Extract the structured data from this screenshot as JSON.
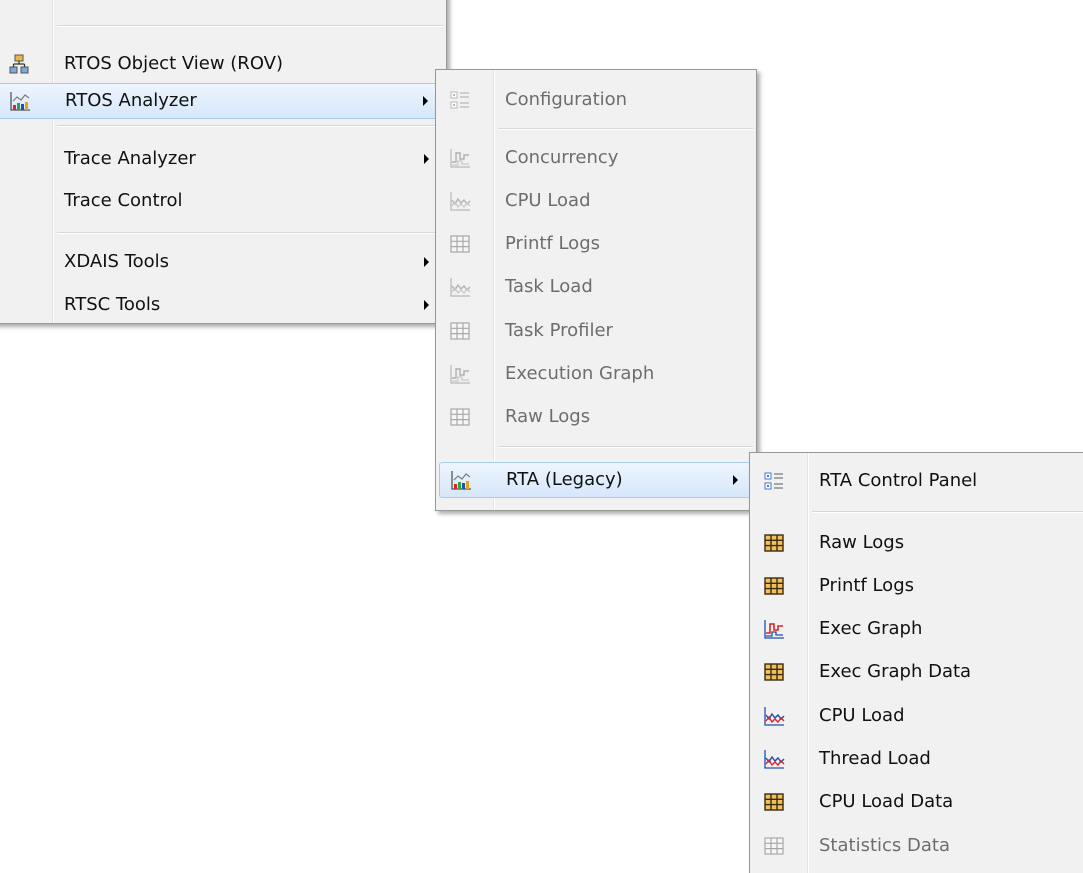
{
  "menu_main": {
    "items": [
      {
        "label": "RTOS Object View (ROV)",
        "icon": "rov-hierarchy-icon"
      },
      {
        "label": "RTOS Analyzer",
        "icon": "analyzer-chart-icon",
        "has_submenu": true,
        "active": true
      },
      {
        "label": "Trace Analyzer",
        "has_submenu": true
      },
      {
        "label": "Trace Control"
      },
      {
        "label": "XDAIS Tools",
        "has_submenu": true
      },
      {
        "label": "RTSC Tools",
        "has_submenu": true
      }
    ]
  },
  "menu_rtos_analyzer": {
    "items": [
      {
        "label": "Configuration",
        "icon": "configuration-icon",
        "disabled": true
      },
      {
        "label": "Concurrency",
        "icon": "step-graph-icon",
        "disabled": true
      },
      {
        "label": "CPU Load",
        "icon": "load-graph-icon",
        "disabled": true
      },
      {
        "label": "Printf Logs",
        "icon": "table-grid-icon",
        "disabled": true
      },
      {
        "label": "Task Load",
        "icon": "load-graph-icon",
        "disabled": true
      },
      {
        "label": "Task Profiler",
        "icon": "table-grid-icon",
        "disabled": true
      },
      {
        "label": "Execution Graph",
        "icon": "step-graph-icon",
        "disabled": true
      },
      {
        "label": "Raw Logs",
        "icon": "table-grid-icon",
        "disabled": true
      },
      {
        "label": "RTA (Legacy)",
        "icon": "analyzer-chart-icon",
        "has_submenu": true,
        "active": true
      }
    ]
  },
  "menu_rta_legacy": {
    "items": [
      {
        "label": "RTA Control Panel",
        "icon": "control-panel-icon"
      },
      {
        "label": "Raw Logs",
        "icon": "table-grid-icon"
      },
      {
        "label": "Printf Logs",
        "icon": "table-grid-icon"
      },
      {
        "label": "Exec Graph",
        "icon": "step-graph-icon"
      },
      {
        "label": "Exec Graph Data",
        "icon": "table-grid-icon"
      },
      {
        "label": "CPU Load",
        "icon": "load-graph-icon"
      },
      {
        "label": "Thread Load",
        "icon": "load-graph-icon"
      },
      {
        "label": "CPU Load Data",
        "icon": "table-grid-icon"
      },
      {
        "label": "Statistics Data",
        "icon": "table-grid-icon",
        "disabled": true
      }
    ]
  },
  "colors": {
    "menu_bg": "#f1f1f1",
    "active_border": "#a9cbf0",
    "disabled_text": "#6d6d6d",
    "table_icon": "#c87810",
    "graph_red": "#d8262a",
    "graph_blue": "#1f4fb0"
  }
}
